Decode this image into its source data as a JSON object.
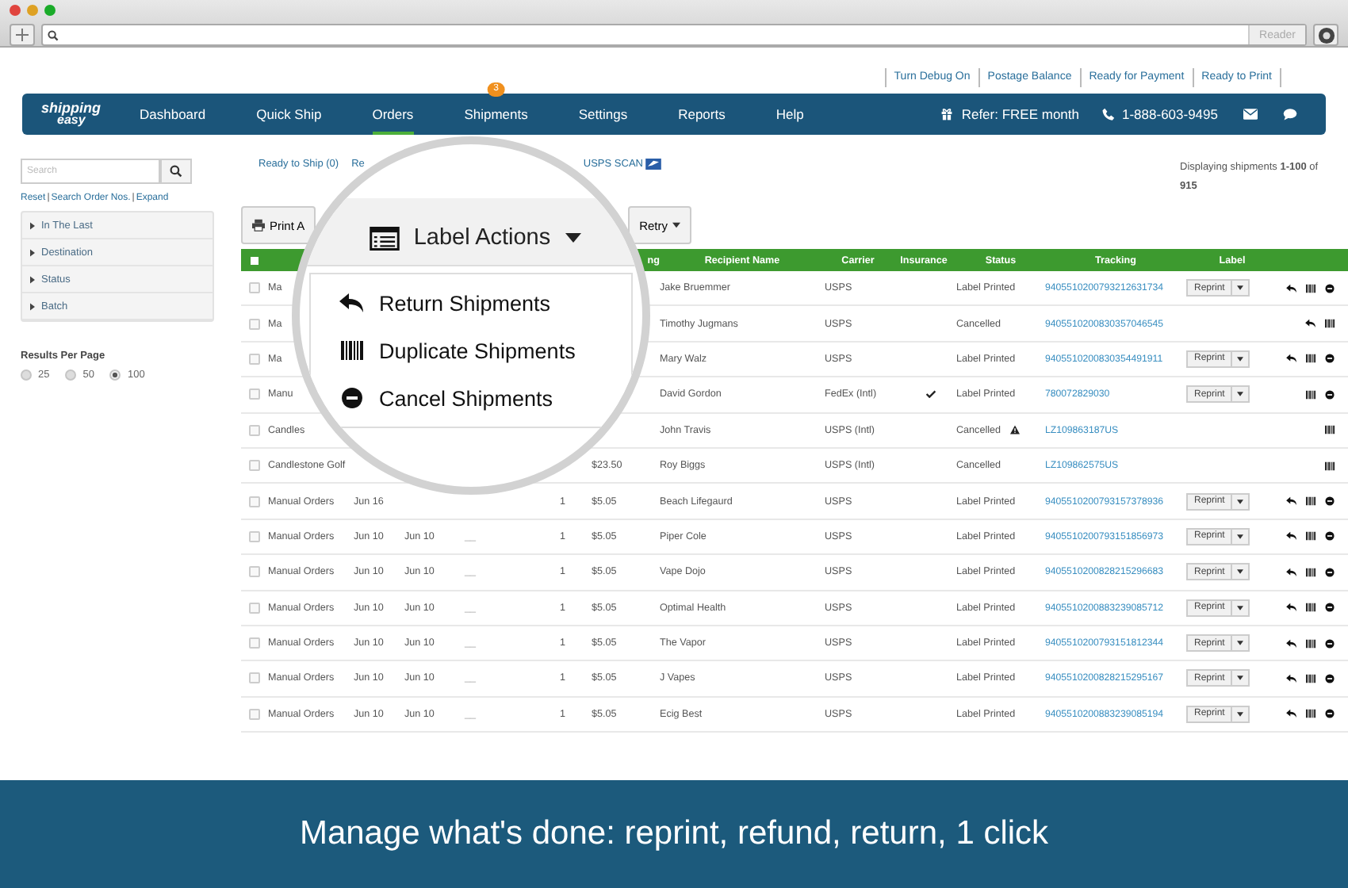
{
  "browser": {
    "reader_button": "Reader"
  },
  "top_links": [
    "Turn Debug On",
    "Postage Balance",
    "Ready for Payment",
    "Ready to Print"
  ],
  "nav": {
    "logo_top": "shipping",
    "logo_bottom": "easy",
    "items": [
      {
        "label": "Dashboard",
        "selected": false
      },
      {
        "label": "Quick Ship",
        "selected": false
      },
      {
        "label": "Orders",
        "selected": true
      },
      {
        "label": "Shipments",
        "selected": false,
        "badge": "3"
      },
      {
        "label": "Settings",
        "selected": false
      },
      {
        "label": "Reports",
        "selected": false
      },
      {
        "label": "Help",
        "selected": false
      }
    ],
    "refer": "Refer: FREE month",
    "phone": "1-888-603-9495"
  },
  "sidebar": {
    "search_placeholder": "Search",
    "links": [
      "Reset",
      "Search Order Nos.",
      "Expand"
    ],
    "link_separator": "|",
    "filters": [
      {
        "label": "In The Last"
      },
      {
        "label": "Destination"
      },
      {
        "label": "Status"
      },
      {
        "label": "Batch"
      }
    ],
    "results_title": "Results Per Page",
    "results_options": [
      {
        "label": "25",
        "selected": false
      },
      {
        "label": "50",
        "selected": false
      },
      {
        "label": "100",
        "selected": true
      }
    ]
  },
  "status_tabs": [
    {
      "label": "Ready to Ship (0)"
    },
    {
      "label": "Re"
    },
    {
      "label": "USPS SCAN",
      "kind": "scan"
    }
  ],
  "display_count": {
    "prefix": "Displaying shipments ",
    "range": "1-100",
    "middle": " of",
    "total": "915"
  },
  "toolbar": {
    "print": "Print A",
    "retry": "Retry"
  },
  "table": {
    "select_all_checked": false,
    "columns": [
      "ng",
      "Recipient Name",
      "Carrier",
      "Insurance",
      "Status",
      "Tracking",
      "Label"
    ],
    "rows": [
      {
        "checked": false,
        "source": "Ma",
        "recipient": "Jake Bruemmer",
        "carrier": "USPS",
        "insured": false,
        "status": "Label Printed",
        "tracking": "9405510200793212631734",
        "label": "Reprint",
        "actions": [
          {
            "kind": "return"
          },
          {
            "kind": "barcode"
          },
          {
            "kind": "cancel"
          }
        ]
      },
      {
        "checked": false,
        "source": "Ma",
        "recipient": "Timothy Jugmans",
        "carrier": "USPS",
        "insured": false,
        "status": "Cancelled",
        "tracking": "9405510200830357046545",
        "actions": [
          {
            "kind": "return"
          },
          {
            "kind": "barcode"
          }
        ]
      },
      {
        "checked": false,
        "source": "Ma",
        "recipient": "Mary Walz",
        "carrier": "USPS",
        "insured": false,
        "status": "Label Printed",
        "tracking": "9405510200830354491911",
        "label": "Reprint",
        "actions": [
          {
            "kind": "return"
          },
          {
            "kind": "barcode"
          },
          {
            "kind": "cancel"
          }
        ]
      },
      {
        "checked": false,
        "source": "Manu",
        "recipient": "David Gordon",
        "carrier": "FedEx (Intl)",
        "insured": true,
        "status": "Label Printed",
        "tracking": "780072829030",
        "label": "Reprint",
        "actions": [
          {
            "kind": "barcode"
          },
          {
            "kind": "cancel"
          }
        ]
      },
      {
        "checked": false,
        "source": "Candles",
        "recipient": "John Travis",
        "carrier": "USPS (Intl)",
        "insured": false,
        "status": "Cancelled",
        "warning": true,
        "tracking": "LZ109863187US",
        "actions": [
          {
            "kind": "barcode"
          }
        ]
      },
      {
        "checked": false,
        "source": "Candlestone Golf",
        "cost": "$23.50",
        "recipient": "Roy Biggs",
        "carrier": "USPS (Intl)",
        "insured": false,
        "status": "Cancelled",
        "tracking": "LZ109862575US",
        "actions": [
          {
            "kind": "barcode"
          }
        ]
      },
      {
        "checked": false,
        "source": "Manual Orders",
        "date1": "Jun 16",
        "qty": "1",
        "cost": "$5.05",
        "recipient": "Beach Lifegaurd",
        "carrier": "USPS",
        "insured": false,
        "status": "Label Printed",
        "tracking": "9405510200793157378936",
        "label": "Reprint",
        "actions": [
          {
            "kind": "return"
          },
          {
            "kind": "barcode"
          },
          {
            "kind": "cancel"
          }
        ]
      },
      {
        "checked": false,
        "source": "Manual Orders",
        "date1": "Jun 10",
        "date2": "Jun 10",
        "dash": "__",
        "qty": "1",
        "cost": "$5.05",
        "recipient": "Piper Cole",
        "carrier": "USPS",
        "insured": false,
        "status": "Label Printed",
        "tracking": "9405510200793151856973",
        "label": "Reprint",
        "actions": [
          {
            "kind": "return"
          },
          {
            "kind": "barcode"
          },
          {
            "kind": "cancel"
          }
        ]
      },
      {
        "checked": false,
        "source": "Manual Orders",
        "date1": "Jun 10",
        "date2": "Jun 10",
        "dash": "__",
        "qty": "1",
        "cost": "$5.05",
        "recipient": "Vape Dojo",
        "carrier": "USPS",
        "insured": false,
        "status": "Label Printed",
        "tracking": "9405510200828215296683",
        "label": "Reprint",
        "actions": [
          {
            "kind": "return"
          },
          {
            "kind": "barcode"
          },
          {
            "kind": "cancel"
          }
        ]
      },
      {
        "checked": false,
        "source": "Manual Orders",
        "date1": "Jun 10",
        "date2": "Jun 10",
        "dash": "__",
        "qty": "1",
        "cost": "$5.05",
        "recipient": "Optimal Health",
        "carrier": "USPS",
        "insured": false,
        "status": "Label Printed",
        "tracking": "9405510200883239085712",
        "label": "Reprint",
        "actions": [
          {
            "kind": "return"
          },
          {
            "kind": "barcode"
          },
          {
            "kind": "cancel"
          }
        ]
      },
      {
        "checked": false,
        "source": "Manual Orders",
        "date1": "Jun 10",
        "date2": "Jun 10",
        "dash": "__",
        "qty": "1",
        "cost": "$5.05",
        "recipient": "The Vapor",
        "carrier": "USPS",
        "insured": false,
        "status": "Label Printed",
        "tracking": "9405510200793151812344",
        "label": "Reprint",
        "actions": [
          {
            "kind": "return"
          },
          {
            "kind": "barcode"
          },
          {
            "kind": "cancel"
          }
        ]
      },
      {
        "checked": false,
        "source": "Manual Orders",
        "date1": "Jun 10",
        "date2": "Jun 10",
        "dash": "__",
        "qty": "1",
        "cost": "$5.05",
        "recipient": "J Vapes",
        "carrier": "USPS",
        "insured": false,
        "status": "Label Printed",
        "tracking": "9405510200828215295167",
        "label": "Reprint",
        "actions": [
          {
            "kind": "return"
          },
          {
            "kind": "barcode"
          },
          {
            "kind": "cancel"
          }
        ]
      },
      {
        "checked": false,
        "source": "Manual Orders",
        "date1": "Jun 10",
        "date2": "Jun 10",
        "dash": "__",
        "qty": "1",
        "cost": "$5.05",
        "recipient": "Ecig Best",
        "carrier": "USPS",
        "insured": false,
        "status": "Label Printed",
        "tracking": "9405510200883239085194",
        "label": "Reprint",
        "actions": [
          {
            "kind": "return"
          },
          {
            "kind": "barcode"
          },
          {
            "kind": "cancel"
          }
        ]
      }
    ]
  },
  "magnifier": {
    "button": "Label Actions",
    "items": [
      {
        "kind": "return",
        "label": "Return Shipments"
      },
      {
        "kind": "barcode",
        "label": "Duplicate Shipments"
      },
      {
        "kind": "cancel",
        "label": "Cancel Shipments"
      }
    ]
  },
  "banner": "Manage what's done: reprint, refund, return, 1 click"
}
